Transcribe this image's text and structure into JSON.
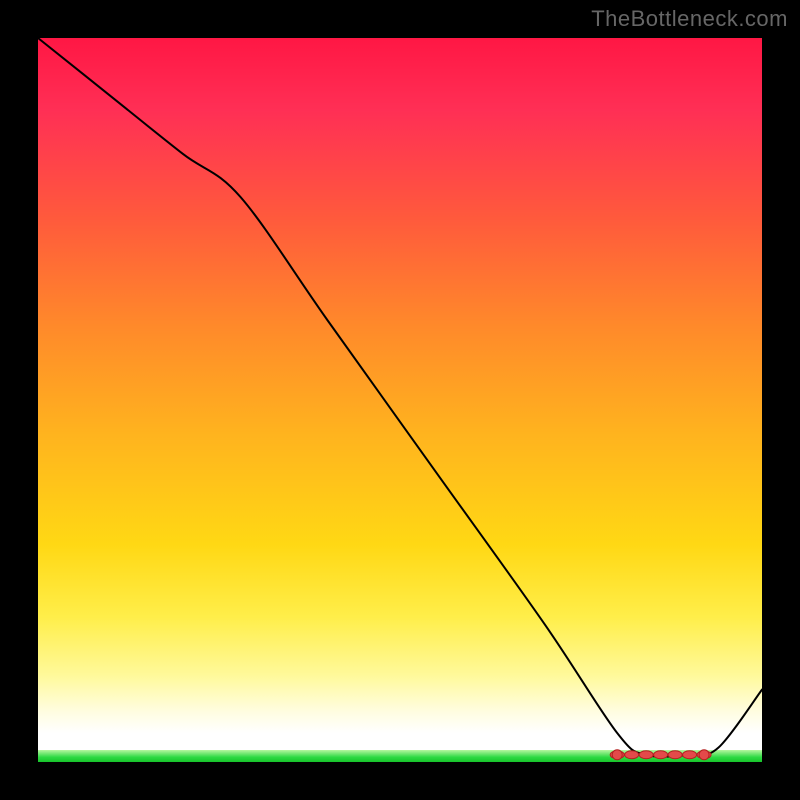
{
  "watermark": "TheBottleneck.com",
  "chart_data": {
    "type": "line",
    "title": "",
    "xlabel": "",
    "ylabel": "",
    "xlim": [
      0,
      100
    ],
    "ylim": [
      0,
      100
    ],
    "grid": false,
    "legend": false,
    "series": [
      {
        "name": "curve",
        "x": [
          0,
          10,
          20,
          28,
          40,
          55,
          70,
          80,
          84,
          90,
          94,
          100
        ],
        "y": [
          100,
          92,
          84,
          78,
          61,
          40,
          19,
          4,
          1,
          1,
          2,
          10
        ]
      }
    ],
    "markers": {
      "x": [
        80,
        82,
        84,
        86,
        88,
        90,
        92
      ],
      "y": [
        1,
        1,
        1,
        1,
        1,
        1,
        1
      ]
    },
    "background_gradient": {
      "top": "#ff1744",
      "mid1": "#ff8a2a",
      "mid2": "#ffd814",
      "low": "#fffde0",
      "bottom_band": "#17c52b"
    }
  }
}
